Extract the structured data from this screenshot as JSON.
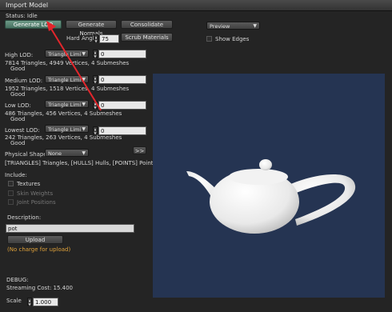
{
  "window": {
    "title": "Import Model"
  },
  "status": {
    "text": "Status: Idle"
  },
  "toolbar": {
    "generate_lod": "Generate LOD",
    "generate_normals": "Generate Normals",
    "consolidate": "Consolidate",
    "scrub_materials": "Scrub Materials",
    "hard_angle_label": "Hard Angle",
    "hard_angle_value": "75"
  },
  "preview_controls": {
    "mode": "Preview",
    "show_edges_label": "Show Edges"
  },
  "lods": [
    {
      "label": "High LOD:",
      "method": "Triangle Limi",
      "value": "0",
      "stats": "7814 Triangles, 4949 Vertices, 4 Submeshes",
      "status": "Good"
    },
    {
      "label": "Medium LOD:",
      "method": "Triangle Limi",
      "value": "0",
      "stats": "1952 Triangles, 1518 Vertices, 4 Submeshes",
      "status": "Good"
    },
    {
      "label": "Low LOD:",
      "method": "Triangle Limi",
      "value": "0",
      "stats": "486 Triangles, 456 Vertices, 4 Submeshes",
      "status": "Good"
    },
    {
      "label": "Lowest LOD:",
      "method": "Triangle Limi",
      "value": "0",
      "stats": "242 Triangles, 263 Vertices, 4 Submeshes",
      "status": "Good"
    }
  ],
  "physics": {
    "label": "Physical Shape:",
    "value": "None",
    "expand": ">>",
    "summary": "[TRIANGLES] Triangles, [HULLS] Hulls, [POINTS] Points"
  },
  "include": {
    "label": "Include:",
    "textures": "Textures",
    "skin_weights": "Skin Weights",
    "joint_positions": "Joint Positions"
  },
  "description": {
    "label": "Description:",
    "value": "pot"
  },
  "upload": {
    "button": "Upload",
    "charge_note": "(No charge for upload)"
  },
  "debug": {
    "label": "DEBUG:",
    "streaming_cost": "Streaming Cost: 15.400"
  },
  "scale": {
    "label": "Scale",
    "value": "1.000"
  },
  "colors": {
    "accent": "#e3262c",
    "preview_bg": "#253452",
    "primary_button": "#5a8674"
  }
}
